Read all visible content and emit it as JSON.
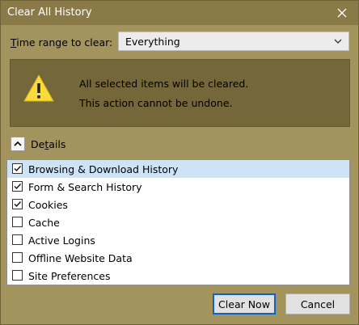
{
  "window": {
    "title": "Clear All History"
  },
  "time_range": {
    "label_prefix": "T",
    "label_rest": "ime range to clear:",
    "selected": "Everything"
  },
  "warning": {
    "line1": "All selected items will be cleared.",
    "line2": "This action cannot be undone."
  },
  "details": {
    "label_prefix": "De",
    "label_underlined": "t",
    "label_rest": "ails"
  },
  "items": [
    {
      "label": "Browsing & Download History",
      "checked": true,
      "selected": true
    },
    {
      "label": "Form & Search History",
      "checked": true,
      "selected": false
    },
    {
      "label": "Cookies",
      "checked": true,
      "selected": false
    },
    {
      "label": "Cache",
      "checked": false,
      "selected": false
    },
    {
      "label": "Active Logins",
      "checked": false,
      "selected": false
    },
    {
      "label": "Offline Website Data",
      "checked": false,
      "selected": false
    },
    {
      "label": "Site Preferences",
      "checked": false,
      "selected": false
    }
  ],
  "buttons": {
    "clear_now": "Clear Now",
    "cancel": "Cancel"
  },
  "colors": {
    "title_bar": "#8a7a48",
    "dialog_bg": "#a3935c",
    "warning_bg": "#74673a",
    "selected_row": "#cfe3f7",
    "default_button_border": "#0a64c8"
  },
  "icons": {
    "close": "close-icon",
    "dropdown": "chevron-down-icon",
    "warning": "warning-icon",
    "collapse": "chevron-up-icon",
    "check": "checkmark-icon"
  }
}
